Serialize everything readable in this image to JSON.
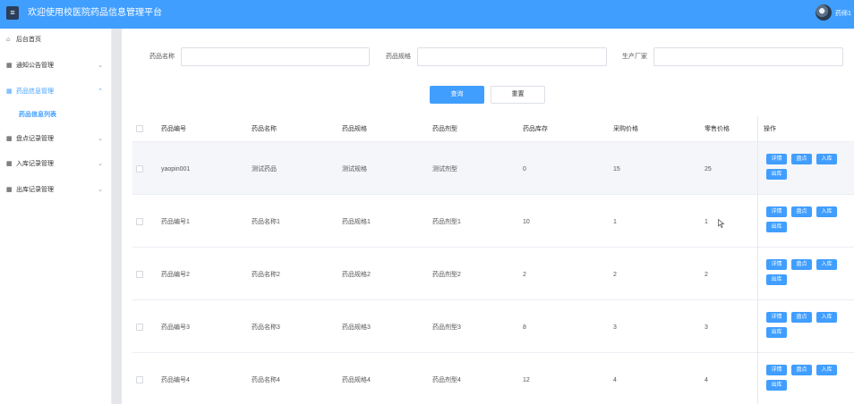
{
  "header": {
    "menu_icon": "hamburger-icon",
    "title": "欢迎使用校医院药品信息管理平台",
    "username": "药师1"
  },
  "sidebar": {
    "items": [
      {
        "label": "后台首页",
        "icon": "home-icon",
        "arrow": ""
      },
      {
        "label": "通知公告管理",
        "icon": "grid-icon",
        "arrow": "⌄"
      },
      {
        "label": "药品信息管理",
        "icon": "grid-icon",
        "arrow": "⌃",
        "active": true
      },
      {
        "label": "盘点记录管理",
        "icon": "grid-icon",
        "arrow": "⌄"
      },
      {
        "label": "入库记录管理",
        "icon": "grid-icon",
        "arrow": "⌄"
      },
      {
        "label": "出库记录管理",
        "icon": "grid-icon",
        "arrow": "⌄"
      }
    ],
    "submenu": "药品信息列表"
  },
  "filters": {
    "name_label": "药品名称",
    "spec_label": "药品规格",
    "maker_label": "生产厂家",
    "name_value": "",
    "spec_value": "",
    "maker_value": ""
  },
  "buttons": {
    "query": "查询",
    "reset": "重置"
  },
  "table": {
    "columns": [
      "药品编号",
      "药品名称",
      "药品规格",
      "药品剂型",
      "药品库存",
      "采购价格",
      "零售价格",
      "操作"
    ],
    "ops": [
      "详情",
      "盘点",
      "入库",
      "出库"
    ],
    "rows": [
      [
        "yaopin001",
        "测试药品",
        "测试规格",
        "测试剂型",
        "0",
        "15",
        "25"
      ],
      [
        "药品编号1",
        "药品名称1",
        "药品规格1",
        "药品剂型1",
        "10",
        "1",
        "1"
      ],
      [
        "药品编号2",
        "药品名称2",
        "药品规格2",
        "药品剂型2",
        "2",
        "2",
        "2"
      ],
      [
        "药品编号3",
        "药品名称3",
        "药品规格3",
        "药品剂型3",
        "8",
        "3",
        "3"
      ],
      [
        "药品编号4",
        "药品名称4",
        "药品规格4",
        "药品剂型4",
        "12",
        "4",
        "4"
      ]
    ]
  },
  "colors": {
    "primary": "#409eff",
    "header_bg": "#409eff",
    "row_hover": "#f4f6f9"
  }
}
